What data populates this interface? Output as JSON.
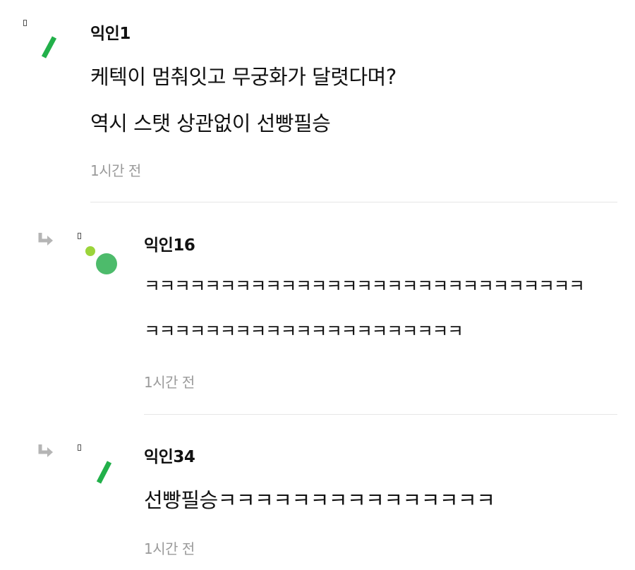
{
  "comments": [
    {
      "author": "익인1",
      "lines": [
        "케텍이 멈춰잇고 무궁화가 달렷다며?",
        "역시 스탯 상관없이 선빵필승"
      ],
      "time": "1시간 전",
      "avatar": "green-stroke-avatar"
    },
    {
      "author": "익인16",
      "lines": [
        "ㅋㅋㅋㅋㅋㅋㅋㅋㅋㅋㅋㅋㅋㅋㅋㅋㅋㅋㅋㅋㅋㅋㅋㅋㅋㅋㅋㅋㅋ",
        "ㅋㅋㅋㅋㅋㅋㅋㅋㅋㅋㅋㅋㅋㅋㅋㅋㅋㅋㅋㅋㅋ"
      ],
      "time": "1시간 전",
      "avatar": "green-dots-avatar"
    },
    {
      "author": "익인34",
      "lines": [
        "선빵필승ㅋㅋㅋㅋㅋㅋㅋㅋㅋㅋㅋㅋㅋㅋㅋ"
      ],
      "time": "1시간 전",
      "avatar": "green-stroke-avatar"
    }
  ],
  "colors": {
    "avatar_green": "#22b04a",
    "avatar_light_green": "#9bd43a",
    "avatar_mid_green": "#4dbb6b",
    "time_gray": "#9a9a9a"
  }
}
